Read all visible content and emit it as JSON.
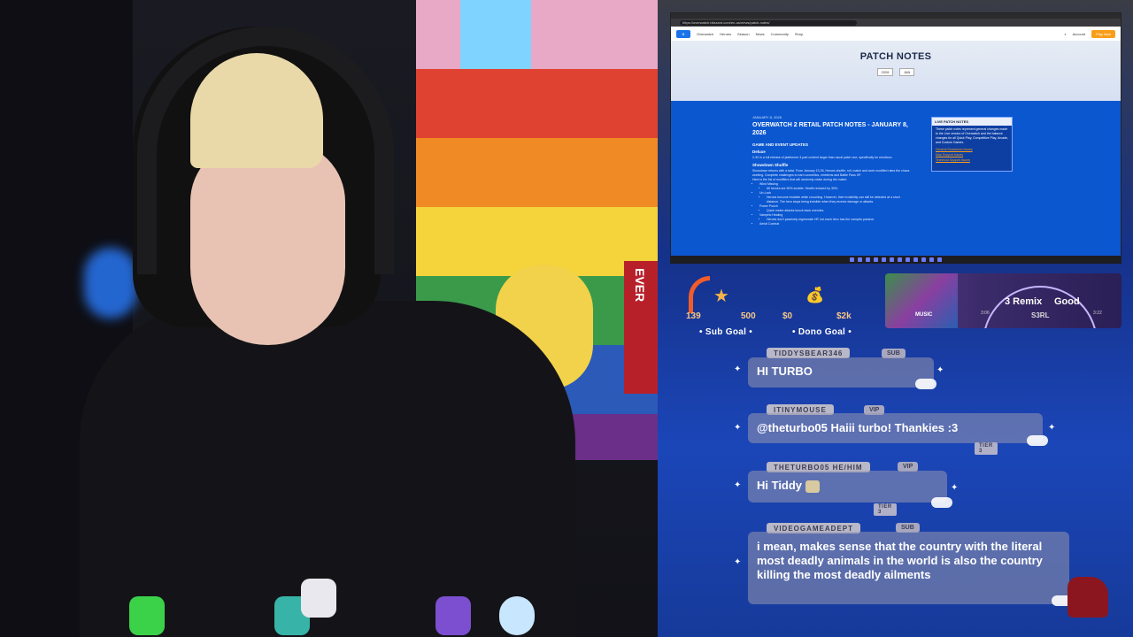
{
  "browser": {
    "url": "https://overwatch.blizzard.com/en-us/news/patch-notes/",
    "nav_items": [
      "Overwatch",
      "Heroes",
      "Season",
      "News",
      "Community",
      "Shop"
    ],
    "account": "Account",
    "play_now": "Play Now",
    "hero_title": "PATCH NOTES",
    "year_select": "2026",
    "month_select": "JAN",
    "article": {
      "date": "JANUARY 8, 2026",
      "title": "OVERWATCH 2 RETAIL PATCH NOTES - JANUARY 8, 2026",
      "section1": "GAME AND EVENT UPDATES",
      "sub1": "Deluxe",
      "p1": "2-3X is a full release of platformer 3-part content larger than usual patch one, specifically for emoticon.",
      "sub2": "Showdown Shuffle",
      "p2": "Showdown returns with a twist. From January 13-26, Heroes shuffle, roll, match and work modified rates the chaos working. Complete challenges to earn cosmetics, emblems and Battle Pass XP.",
      "p3": "Here is the list of modifiers that will randomly rotate during the match:",
      "bullets": [
        "Wind Missing",
        "All heroes are 50% smaller. Health reduced by 30%.",
        "Un-Lock",
        "Heroes become invisible while crouching. However, their invisibility can still be detected at a short distance. The hero stops being invisible when they receive damage or attacks.",
        "Power Punch",
        "Quick melee attacks knock back enemies.",
        "Vampiric Healing",
        "Heroes don't passively regenerate HP, but each hero has the vampiric passive.",
        "Aerial Combat"
      ]
    },
    "sidebox": {
      "header": "LIVE PATCH NOTES",
      "text": "These patch notes represent general changes made to the Live version of Overwatch and the balance changes for all Quick Play, Competitive Play, Arcade, and Custom Games.",
      "links": [
        "General Showdown Issues",
        "Map Support Issues",
        "Technical Support Issues"
      ]
    }
  },
  "goals": {
    "sub": {
      "current": "139",
      "target": "500",
      "label": "• Sub Goal •",
      "progress": 0.278
    },
    "dono": {
      "current": "$0",
      "target": "$2k",
      "label": "• Dono Goal •",
      "progress": 0
    }
  },
  "music": {
    "title": "3 Remix",
    "title2": "Good",
    "artist": "S3RL",
    "time_elapsed": "3:06",
    "time_total": "3:22",
    "album_text": "MUSIC"
  },
  "chat": [
    {
      "user": "TIDDYSBEAR346",
      "badge": "SUB",
      "text": "HI TURBO",
      "tier": ""
    },
    {
      "user": "ITINYMOUSE",
      "badge": "VIP",
      "text": "@theturbo05 Haiii turbo! Thankies :3",
      "tier": "TIER 3"
    },
    {
      "user": "THETURBO05 HE/HIM",
      "badge": "VIP",
      "text": "Hi Tiddy",
      "tier": "TIER 3"
    },
    {
      "user": "VIDEOGAMEADEPT",
      "badge": "SUB",
      "text": "i mean, makes sense that the country with the literal most deadly animals in the world is also the country killing the most deadly ailments",
      "tier": ""
    }
  ],
  "webcam": {
    "sign_text": "EVER"
  },
  "colors": {
    "chat_bubble": "#9696af",
    "goal_accent": "#f25c2b",
    "goal_text": "#f9c784",
    "page_blue": "#0b57d0"
  }
}
